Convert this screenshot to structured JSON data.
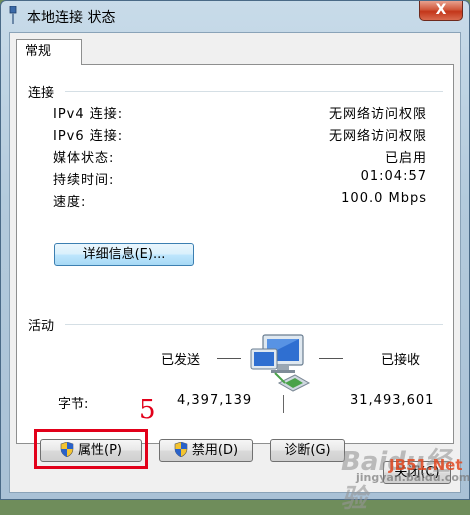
{
  "window": {
    "title": "本地连接 状态",
    "close_glyph": "X"
  },
  "tabs": [
    {
      "label": "常规",
      "active": true
    }
  ],
  "connection": {
    "title": "连接",
    "rows": [
      {
        "label": "IPv4 连接:",
        "value": "无网络访问权限"
      },
      {
        "label": "IPv6 连接:",
        "value": "无网络访问权限"
      },
      {
        "label": "媒体状态:",
        "value": "已启用"
      },
      {
        "label": "持续时间:",
        "value": "01:04:57"
      },
      {
        "label": "速度:",
        "value": "100.0 Mbps"
      }
    ],
    "details_button": "详细信息(E)..."
  },
  "activity": {
    "title": "活动",
    "sent_label": "已发送",
    "received_label": "已接收",
    "bytes_label": "字节:",
    "bytes_sent": "4,397,139",
    "bytes_received": "31,493,601"
  },
  "buttons": {
    "properties": "属性(P)",
    "disable": "禁用(D)",
    "diagnose": "诊断(G)",
    "close": "关闭(C)"
  },
  "annotation": {
    "step_number": "5",
    "highlight_color": "#e2001a"
  },
  "watermarks": {
    "baidu": "Baidu经验",
    "url": "jingyan.baidu.com",
    "jb51": "JB51.Net"
  },
  "icons": {
    "title": "network-cable-icon",
    "activity": "network-computers-icon",
    "uac": "uac-shield-icon"
  }
}
